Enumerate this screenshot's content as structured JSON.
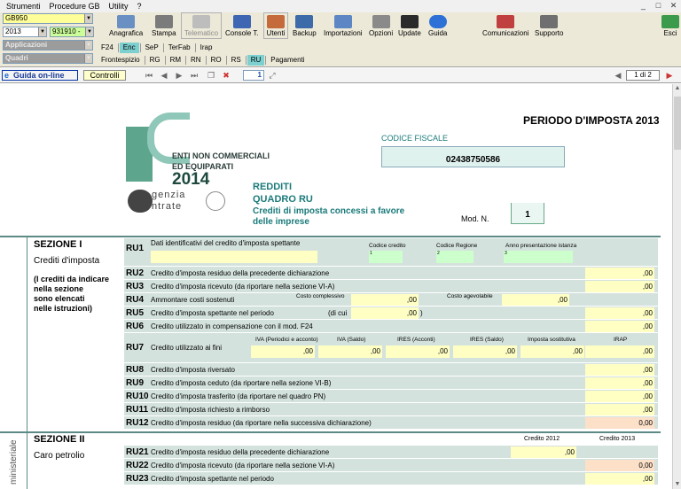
{
  "menu": [
    "Strumenti",
    "Procedure GB",
    "Utility",
    "?"
  ],
  "window_controls": {
    "minimize": "_",
    "maximize": "□",
    "close": "✕"
  },
  "combos": {
    "firm": "GB950",
    "year": "2013",
    "code": "931910 -",
    "applicazioni": "Applicazioni",
    "quadri": "Quadri"
  },
  "toolbar": {
    "anagrafica": "Anagrafica",
    "stampa": "Stampa",
    "telematico": "Telematico",
    "console": "Console T.",
    "utenti": "Utenti",
    "backup": "Backup",
    "importazioni": "Importazioni",
    "opzioni": "Opzioni",
    "update": "Update",
    "guida": "Guida",
    "comunicazioni": "Comunicazioni",
    "supporto": "Supporto",
    "esci": "Esci"
  },
  "tabs_top": [
    "F24",
    "Enc",
    "SeP",
    "TerFab",
    "Irap"
  ],
  "tabs_bottom": [
    "Frontespizio",
    "RG",
    "RM",
    "RN",
    "RO",
    "RS",
    "RU",
    "Pagamenti"
  ],
  "navbar": {
    "guida_online": "Guida on-line",
    "controlli": "Controlli",
    "page": "1",
    "page_count": "1 di 2"
  },
  "doc": {
    "periodo": "PERIODO D'IMPOSTA 2013",
    "logo_line1": "ENTI NON COMMERCIALI",
    "logo_line2": "ED EQUIPARATI",
    "logo_year": "2014",
    "agenzia": "genzia",
    "entrate": "ntrate",
    "codice_fiscale_label": "CODICE FISCALE",
    "codice_fiscale": "02438750586",
    "redditi": "REDDITI",
    "quadro": "QUADRO RU",
    "quadro_desc1": "Crediti di imposta concessi a favore",
    "quadro_desc2": "delle imprese",
    "mod_label": "Mod. N.",
    "mod_value": "1",
    "ministeriale": "ministeriale",
    "sez1": {
      "title": "SEZIONE I",
      "subtitle": "Crediti d'imposta",
      "note": [
        "(I crediti da indicare",
        "nella sezione",
        "sono elencati",
        "nelle istruzioni)"
      ]
    },
    "sez2": {
      "title": "SEZIONE II",
      "subtitle": "Caro petrolio",
      "credito2012": "Credito 2012",
      "credito2013": "Credito 2013"
    },
    "ru1": {
      "code": "RU1",
      "desc": "Dati identificativi del credito d'imposta spettante",
      "codice_credito": "Codice credito",
      "codice_regione": "Codice Regione",
      "anno": "Anno presentazione istanza"
    },
    "ru4": {
      "code": "RU4",
      "desc": "Ammontare costi sostenuti",
      "lbl1": "Costo complessivo",
      "lbl2": "Costo agevolabile",
      "v1": ",00",
      "v2": ",00"
    },
    "ru5": {
      "code": "RU5",
      "desc": "Credito d'imposta spettante nel periodo",
      "dicui": "(di cui",
      "v1": ",00",
      "close": ")",
      "v2": ",00"
    },
    "ru7": {
      "code": "RU7",
      "desc": "Credito utilizzato ai fini",
      "labels": [
        "IVA (Periodici e acconto)",
        "IVA (Saldo)",
        "IRES (Acconti)",
        "IRES (Saldo)",
        "Imposta sostitutiva",
        "IRAP"
      ],
      "values": [
        ",00",
        ",00",
        ",00",
        ",00",
        ",00",
        ",00"
      ]
    },
    "rows": [
      {
        "code": "RU2",
        "desc": "Credito d'imposta residuo della precedente dichiarazione",
        "val": ",00"
      },
      {
        "code": "RU3",
        "desc": "Credito d'imposta ricevuto (da riportare nella sezione VI-A)",
        "val": ",00"
      },
      {
        "code": "RU6",
        "desc": "Credito utilizzato in compensazione con il mod. F24",
        "val": ",00"
      },
      {
        "code": "RU8",
        "desc": "Credito d'imposta riversato",
        "val": ",00"
      },
      {
        "code": "RU9",
        "desc": "Credito d'imposta ceduto (da riportare nella sezione VI-B)",
        "val": ",00"
      },
      {
        "code": "RU10",
        "desc": "Credito d'imposta trasferito (da riportare nel quadro PN)",
        "val": ",00"
      },
      {
        "code": "RU11",
        "desc": "Credito d'imposta richiesto a rimborso",
        "val": ",00"
      },
      {
        "code": "RU12",
        "desc": "Credito d'imposta residuo (da riportare nella successiva dichiarazione)",
        "val": "0,00"
      }
    ],
    "ru21": {
      "code": "RU21",
      "desc": "Credito d'imposta residuo della precedente dichiarazione",
      "v1": ",00"
    },
    "ru22": {
      "code": "RU22",
      "desc": "Credito d'imposta ricevuto (da riportare nella sezione VI-A)",
      "v2": "0,00"
    },
    "ru23": {
      "code": "RU23",
      "desc": "Credito d'imposta spettante nel periodo",
      "v2": ",00"
    }
  }
}
